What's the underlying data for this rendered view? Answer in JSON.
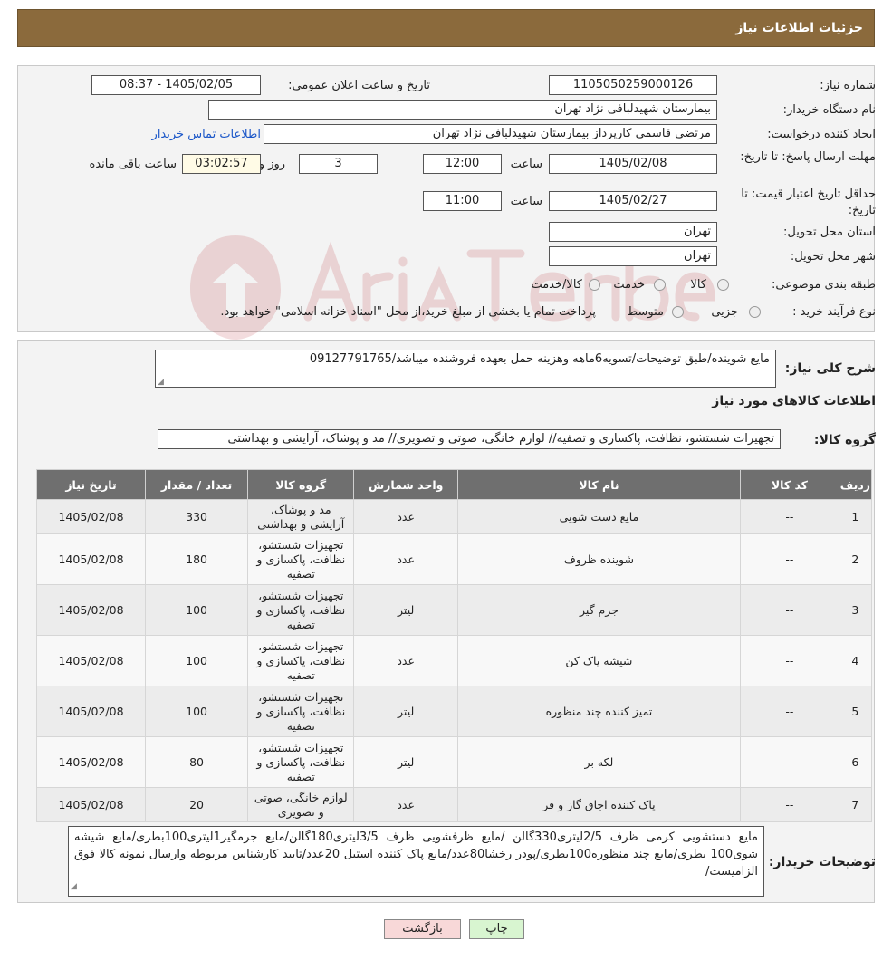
{
  "header": {
    "title": "جزئیات اطلاعات نیاز"
  },
  "form": {
    "need_number_label": "شماره نیاز:",
    "need_number": "1105050259000126",
    "announce_label": "تاریخ و ساعت اعلان عمومی:",
    "announce_value": "1405/02/05 - 08:37",
    "buyer_org_label": "نام دستگاه خریدار:",
    "buyer_org": "بیمارستان شهیدلبافی نژاد تهران",
    "creator_label": "ایجاد کننده درخواست:",
    "creator": "مرتضی  قاسمی کارپرداز بیمارستان شهیدلبافی نژاد تهران",
    "contact_link": "اطلاعات تماس خریدار",
    "reply_deadline_label": "مهلت ارسال پاسخ: تا تاریخ:",
    "reply_date": "1405/02/08",
    "time_label": "ساعت",
    "reply_time": "12:00",
    "days_value": "3",
    "days_label": "روز و",
    "remaining_time": "03:02:57",
    "remaining_label": "ساعت باقی مانده",
    "validity_label": "حداقل تاریخ اعتبار قیمت: تا تاریخ:",
    "validity_date": "1405/02/27",
    "validity_time": "11:00",
    "province_label": "استان محل تحویل:",
    "province": "تهران",
    "city_label": "شهر محل تحویل:",
    "city": "تهران",
    "category_label": "طبقه بندی موضوعی:",
    "category_options": [
      "کالا",
      "خدمت",
      "کالا/خدمت"
    ],
    "process_label": "نوع فرآیند خرید :",
    "process_options": [
      "جزیی",
      "متوسط"
    ],
    "process_note": "پرداخت تمام یا بخشی از مبلغ خرید،از محل \"اسناد خزانه اسلامی\" خواهد بود."
  },
  "details": {
    "summary_label": "شرح کلی نیاز:",
    "summary": "مایع شوینده/طبق توضیحات/تسویه6ماهه وهزینه حمل بعهده فروشنده میباشد/09127791765",
    "goods_info_title": "اطلاعات کالاهای مورد نیاز",
    "group_label": "گروه کالا:",
    "group_value": "تجهیزات شستشو، نظافت، پاکسازی و تصفیه// لوازم خانگی، صوتی و تصویری// مد و پوشاک، آرایشی و بهداشتی",
    "columns": [
      "ردیف",
      "کد کالا",
      "نام کالا",
      "واحد شمارش",
      "گروه کالا",
      "تعداد / مقدار",
      "تاریخ نیاز"
    ],
    "rows": [
      [
        "1",
        "--",
        "مایع دست شویی",
        "عدد",
        "مد و پوشاک، آرایشی و بهداشتی",
        "330",
        "1405/02/08"
      ],
      [
        "2",
        "--",
        "شوینده ظروف",
        "عدد",
        "تجهیزات شستشو، نظافت، پاکسازی و تصفیه",
        "180",
        "1405/02/08"
      ],
      [
        "3",
        "--",
        "جرم گیر",
        "لیتر",
        "تجهیزات شستشو، نظافت، پاکسازی و تصفیه",
        "100",
        "1405/02/08"
      ],
      [
        "4",
        "--",
        "شیشه پاک کن",
        "عدد",
        "تجهیزات شستشو، نظافت، پاکسازی و تصفیه",
        "100",
        "1405/02/08"
      ],
      [
        "5",
        "--",
        "تمیز کننده چند منظوره",
        "لیتر",
        "تجهیزات شستشو، نظافت، پاکسازی و تصفیه",
        "100",
        "1405/02/08"
      ],
      [
        "6",
        "--",
        "لکه بر",
        "لیتر",
        "تجهیزات شستشو، نظافت، پاکسازی و تصفیه",
        "80",
        "1405/02/08"
      ],
      [
        "7",
        "--",
        "پاک کننده اجاق گاز و فر",
        "عدد",
        "لوازم خانگی، صوتی و تصویری",
        "20",
        "1405/02/08"
      ]
    ],
    "buyer_notes_label": "توضیحات خریدار:",
    "buyer_notes": "مایع دستشویی کرمی ظرف 2/5لیتری330گالن /مایع ظرفشویی ظرف 3/5لیتری180گالن/مایع جرمگیر1لیتری100بطری/مایع شیشه شوی100 بطری/مایع چند منظوره100بطری/پودر رخشا80عدد/مایع پاک کننده استیل 20عدد/تایید کارشناس مربوطه وارسال نمونه کالا فوق الزامیست/"
  },
  "buttons": {
    "print": "چاپ",
    "back": "بازگشت"
  },
  "colors": {
    "header_bg": "#8b6a3c",
    "table_header_bg": "#6f6f6f",
    "link": "#1a56c8",
    "print_btn": "#d8f5d0",
    "back_btn": "#f8d8d8"
  }
}
